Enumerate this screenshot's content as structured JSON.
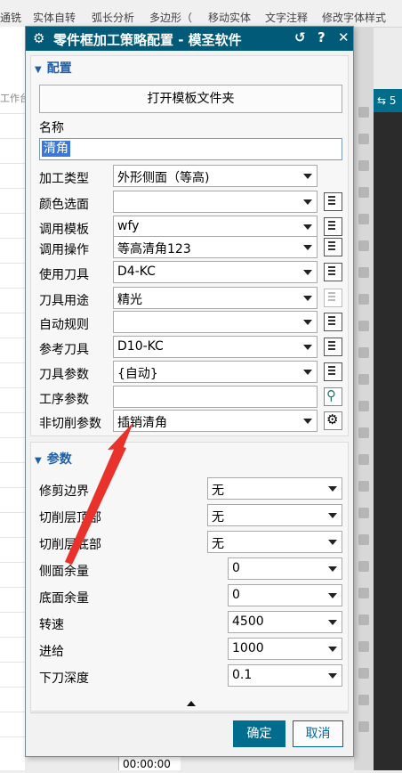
{
  "app": {
    "toolbar": [
      "通铣",
      "实体自转",
      "弧长分析",
      "多边形（",
      "移动实体",
      "文字注释",
      "修改字体样式"
    ],
    "left_label": "工作台",
    "right_tab": "⇆ 5",
    "time": "00:00:00"
  },
  "dialog": {
    "title": "零件框加工策略配置 - 模圣软件",
    "section1": "配置",
    "open_template_button": "打开模板文件夹",
    "name_label": "名称",
    "name_value": "清角",
    "rows": [
      {
        "label": "加工类型",
        "value": "外形侧面（等高)"
      },
      {
        "label": "颜色选面",
        "value": ""
      },
      {
        "label": "调用模板",
        "value": "wfy"
      },
      {
        "label": "调用操作",
        "value": "等高清角123"
      },
      {
        "label": "使用刀具",
        "value": "D4-KC"
      },
      {
        "label": "刀具用途",
        "value": "精光"
      },
      {
        "label": "自动规则",
        "value": ""
      },
      {
        "label": "参考刀具",
        "value": "D10-KC"
      },
      {
        "label": "刀具参数",
        "value": "{自动}"
      },
      {
        "label": "工序参数",
        "value": ""
      },
      {
        "label": "非切削参数",
        "value": "插销清角"
      }
    ],
    "section2": "参数",
    "params": [
      {
        "label": "修剪边界",
        "value": "无"
      },
      {
        "label": "切削层顶部",
        "value": "无"
      },
      {
        "label": "切削层底部",
        "value": "无"
      },
      {
        "label": "侧面余量",
        "value": "0"
      },
      {
        "label": "底面余量",
        "value": "0"
      },
      {
        "label": "转速",
        "value": "4500"
      },
      {
        "label": "进给",
        "value": "1000"
      },
      {
        "label": "下刀深度",
        "value": "0.1"
      }
    ],
    "ok": "确定",
    "cancel": "取消"
  },
  "colors": {
    "titlebar": "#005a78",
    "accent": "#1e5fa8",
    "annotation_arrow": "#e8322b"
  }
}
